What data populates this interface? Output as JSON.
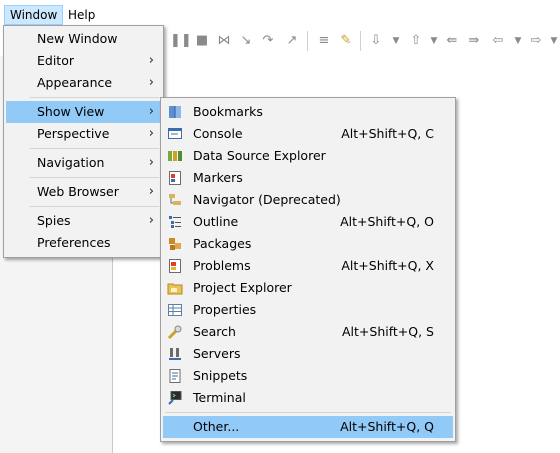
{
  "menubar": {
    "window_label": "Window",
    "help_label": "Help"
  },
  "window_menu": {
    "items": [
      {
        "label": "New Window",
        "submenu": false
      },
      {
        "label": "Editor",
        "submenu": true
      },
      {
        "label": "Appearance",
        "submenu": true
      },
      {
        "label": "Show View",
        "submenu": true,
        "highlighted": true
      },
      {
        "label": "Perspective",
        "submenu": true
      },
      {
        "label": "Navigation",
        "submenu": true
      },
      {
        "label": "Web Browser",
        "submenu": true
      },
      {
        "label": "Spies",
        "submenu": true
      },
      {
        "label": "Preferences",
        "submenu": false
      }
    ],
    "arrow": "›"
  },
  "show_view_menu": {
    "items": [
      {
        "label": "Bookmarks",
        "accel": "",
        "icon": "bookmarks-icon"
      },
      {
        "label": "Console",
        "accel": "Alt+Shift+Q, C",
        "icon": "console-icon"
      },
      {
        "label": "Data Source Explorer",
        "accel": "",
        "icon": "data-source-explorer-icon"
      },
      {
        "label": "Markers",
        "accel": "",
        "icon": "markers-icon"
      },
      {
        "label": "Navigator (Deprecated)",
        "accel": "",
        "icon": "navigator-icon"
      },
      {
        "label": "Outline",
        "accel": "Alt+Shift+Q, O",
        "icon": "outline-icon"
      },
      {
        "label": "Packages",
        "accel": "",
        "icon": "packages-icon"
      },
      {
        "label": "Problems",
        "accel": "Alt+Shift+Q, X",
        "icon": "problems-icon"
      },
      {
        "label": "Project Explorer",
        "accel": "",
        "icon": "project-explorer-icon"
      },
      {
        "label": "Properties",
        "accel": "",
        "icon": "properties-icon"
      },
      {
        "label": "Search",
        "accel": "Alt+Shift+Q, S",
        "icon": "search-icon"
      },
      {
        "label": "Servers",
        "accel": "",
        "icon": "servers-icon"
      },
      {
        "label": "Snippets",
        "accel": "",
        "icon": "snippets-icon"
      },
      {
        "label": "Terminal",
        "accel": "",
        "icon": "terminal-icon"
      },
      {
        "label": "Other...",
        "accel": "Alt+Shift+Q, Q",
        "icon": "",
        "highlighted": true
      }
    ]
  },
  "colors": {
    "highlight": "#91c9f7",
    "menu_bg": "#f2f2f2",
    "menubar_active": "#cce8ff"
  }
}
